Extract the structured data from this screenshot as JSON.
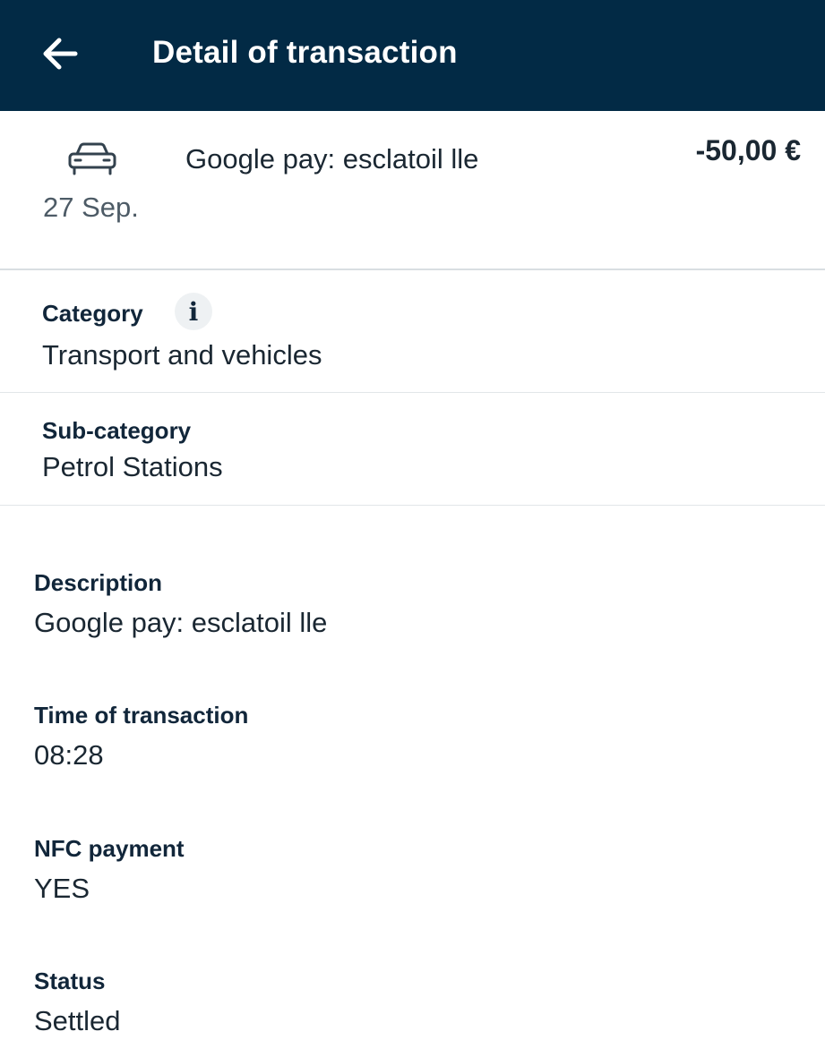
{
  "appbar": {
    "title": "Detail of transaction",
    "back_icon": "arrow-left-icon",
    "background": "#022a45"
  },
  "summary": {
    "icon": "car-icon",
    "merchant": "Google pay: esclatoil lle",
    "date": "27 Sep.",
    "amount": "-50,00 €"
  },
  "category": {
    "label": "Category",
    "info_icon": "info-icon",
    "info_glyph": "i",
    "value": "Transport and vehicles"
  },
  "subcategory": {
    "label": "Sub-category",
    "value": "Petrol Stations"
  },
  "details": [
    {
      "label": "Description",
      "value": "Google pay: esclatoil lle"
    },
    {
      "label": "Time of transaction",
      "value": "08:28"
    },
    {
      "label": "NFC payment",
      "value": "YES"
    },
    {
      "label": "Status",
      "value": "Settled"
    }
  ]
}
